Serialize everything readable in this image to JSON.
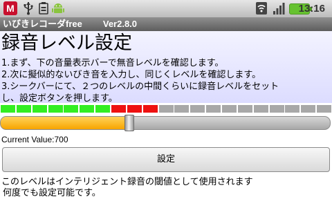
{
  "status_bar": {
    "icons_left": [
      "mcafee-icon",
      "usb-icon",
      "debug-icon",
      "android-icon"
    ],
    "icons_right": [
      "wifi-icon",
      "signal-icon",
      "battery-icon"
    ],
    "mcafee_letter": "M",
    "time": "13:16"
  },
  "title_bar": {
    "app_name": "いびきレコーダfree",
    "version": "Ver2.8.0"
  },
  "main": {
    "heading": "録音レベル設定",
    "instructions": [
      "1.まず、下の音量表示バーで無音レベルを確認します。",
      "2.次に擬似的ないびき音を入力し、同じくレベルを確認します。",
      "3.シークバーにて、２つのレベルの中間くらいに録音レベルをセット",
      "し、設定ボタンを押します。"
    ]
  },
  "meter": {
    "segment_count": 21,
    "segments": [
      "green",
      "green",
      "green",
      "green",
      "green",
      "green",
      "green",
      "red",
      "red",
      "red",
      "gray",
      "gray",
      "gray",
      "gray",
      "gray",
      "gray",
      "gray",
      "gray",
      "gray",
      "gray",
      "gray"
    ],
    "colors": {
      "green": "#33ee22",
      "red": "#ee1111",
      "gray": "#a8a8a8"
    }
  },
  "slider": {
    "fraction": 0.39,
    "fill_color": "#f7a400"
  },
  "current_value": "Current Value:700",
  "set_button": {
    "label": "設定"
  },
  "footer": {
    "line1": "このレベルはインテリジェント録音の閾値として使用されます",
    "line2": "何度でも設定可能です。"
  }
}
